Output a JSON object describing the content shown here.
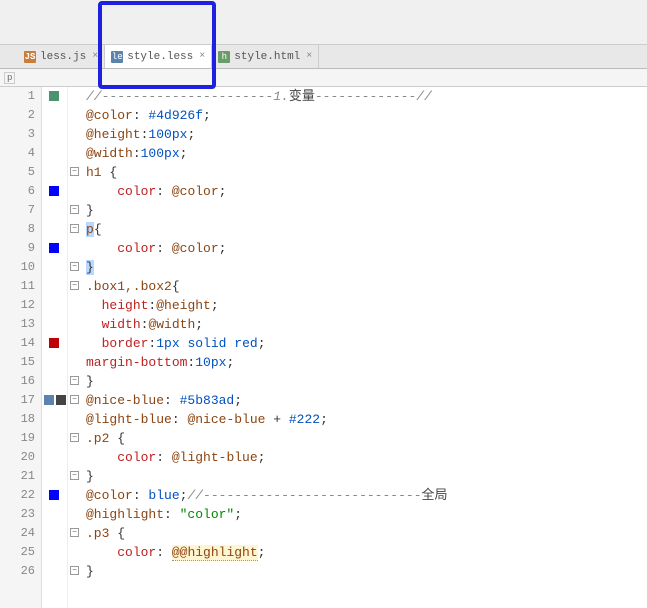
{
  "tabs": [
    {
      "icon": "js",
      "label": "less.js"
    },
    {
      "icon": "le",
      "label": "style.less"
    },
    {
      "icon": "h",
      "label": "style.html"
    }
  ],
  "breadcrumb": "p",
  "markers": [
    {
      "line": 1,
      "color": "#4d926f"
    },
    {
      "line": 6,
      "color": "#0000ff"
    },
    {
      "line": 9,
      "color": "#0000ff"
    },
    {
      "line": 14,
      "color": "#c00000"
    },
    {
      "line": 17,
      "color": "#5b83ad",
      "x": 0
    },
    {
      "line": 17,
      "color": "#444",
      "x": 12
    },
    {
      "line": 22,
      "color": "#0000ff"
    }
  ],
  "chart_data": {
    "type": "table",
    "title": "LESS code — style.less",
    "lines": [
      "//----------------------1.变量-------------//",
      "@color: #4d926f;",
      "@height:100px;",
      "@width:100px;",
      "h1 {",
      "    color: @color;",
      "}",
      "p{",
      "    color: @color;",
      "}",
      ".box1,.box2{",
      "  height:@height;",
      "  width:@width;",
      "  border:1px solid red;",
      "margin-bottom:10px;",
      "}",
      "@nice-blue: #5b83ad;",
      "@light-blue: @nice-blue + #222;",
      ".p2 {",
      "    color: @light-blue;",
      "}",
      "@color: blue;//----------------------------全局",
      "@highlight: \"color\";",
      ".p3 {",
      "    color: @@highlight;",
      "}"
    ],
    "tokens": {
      "comment1_a": "//----------------------1.",
      "comment1_b": "变量",
      "comment1_c": "-------------//",
      "at_color": "@color",
      "hex4d": "#4d926f",
      "at_height": "@height",
      "px100a": "100px",
      "at_width": "@width",
      "px100b": "100px",
      "sel_h1": "h1 ",
      "brace_o": "{",
      "prop_color": "color",
      "colon": ":",
      "semi": ";",
      "brace_c": "}",
      "sel_p": "p",
      "sel_box": ".box1,.box2",
      "prop_height": "height",
      "prop_width": "width",
      "prop_border": "border",
      "val_1px": "1px",
      "val_solid": "solid",
      "val_red": "red",
      "prop_mb": "margin-bottom",
      "val_10px": "10px",
      "at_niceblue": "@nice-blue",
      "hex5b": "#5b83ad",
      "at_lightblue": "@light-blue",
      "plus": " + ",
      "hex222": "#222",
      "sel_p2": ".p2 ",
      "val_blue": "blue",
      "comment22_a": "//----------------------------",
      "comment22_b": "全局",
      "at_highlight": "@highlight",
      "str_color": "\"color\"",
      "sel_p3": ".p3 ",
      "at_at_highlight": "@@highlight"
    }
  }
}
